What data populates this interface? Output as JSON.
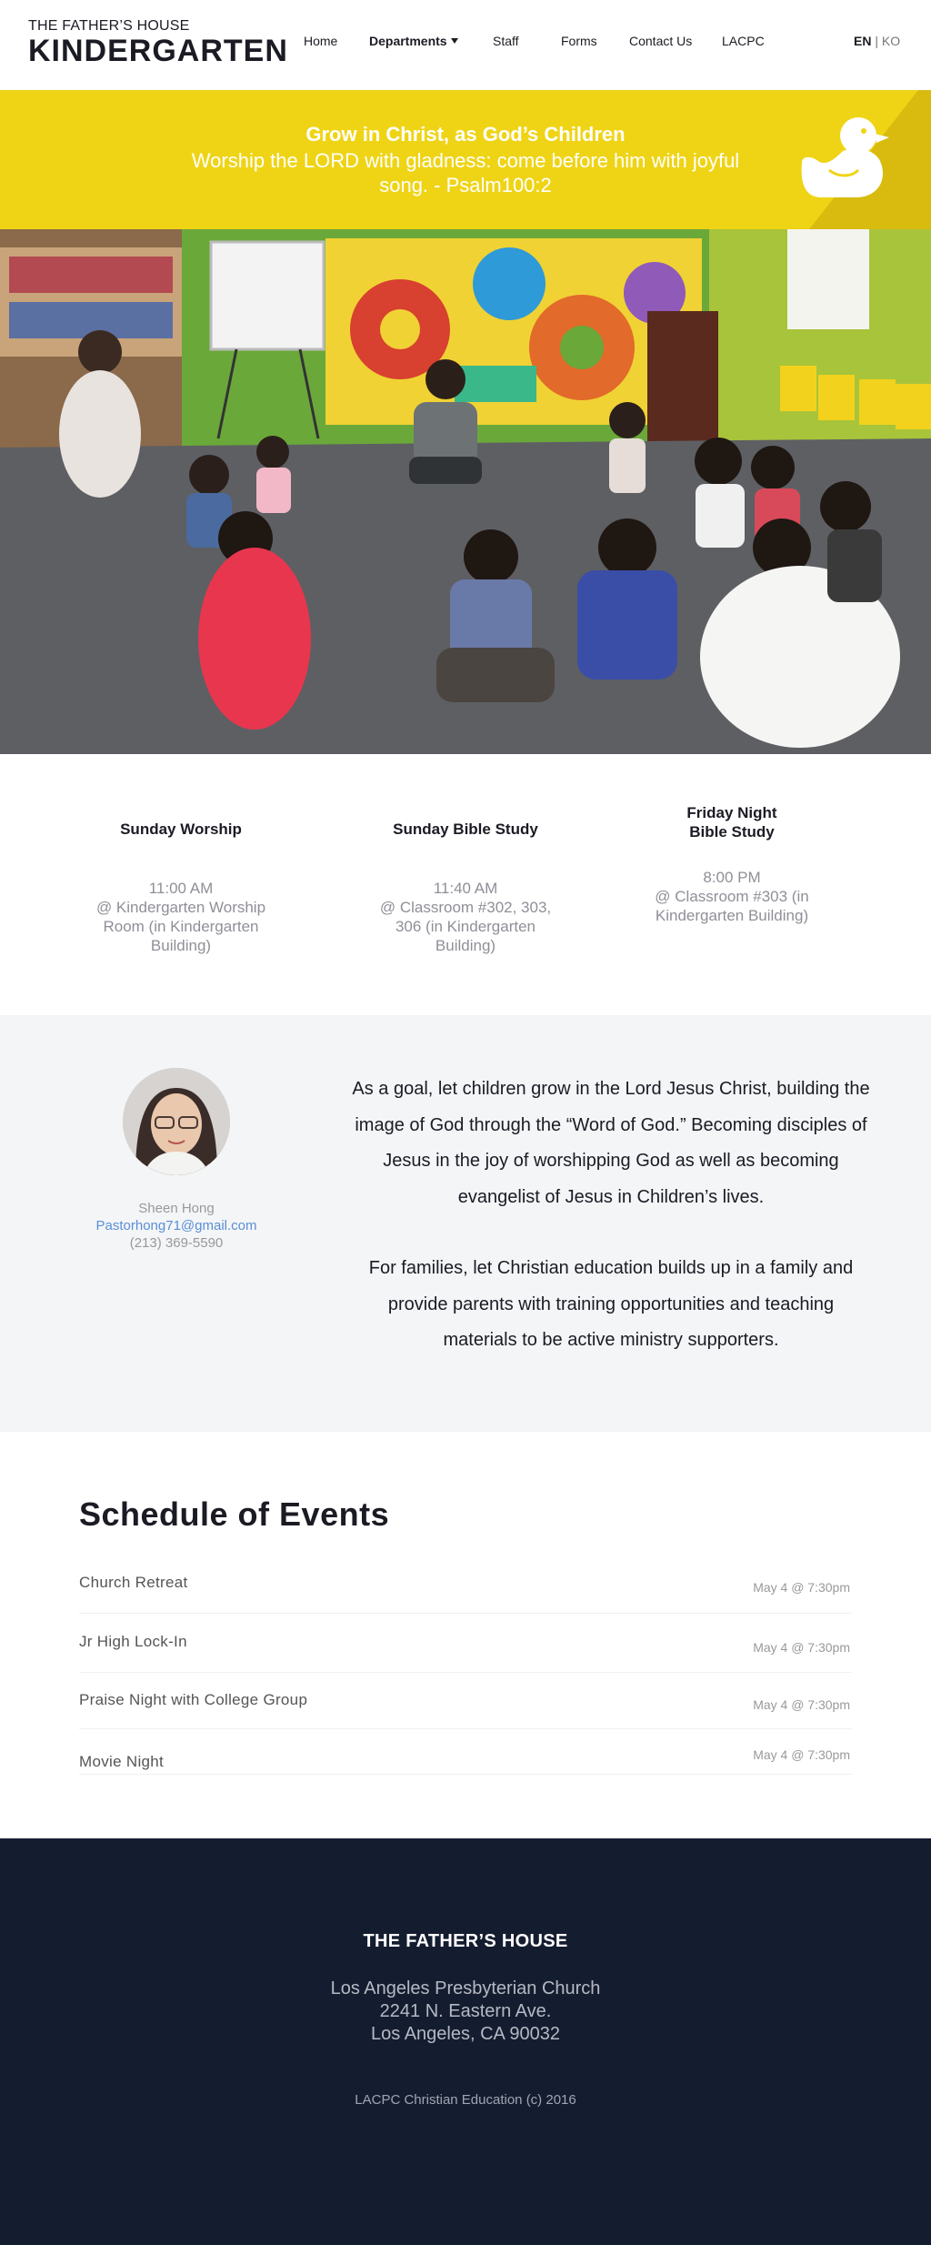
{
  "header": {
    "logo_top": "THE FATHER’S HOUSE",
    "logo_main": "KINDERGARTEN",
    "nav": [
      {
        "label": "Home"
      },
      {
        "label": "Departments"
      },
      {
        "label": "Staff"
      },
      {
        "label": "Forms"
      },
      {
        "label": "Contact Us"
      },
      {
        "label": "LACPC"
      }
    ],
    "lang_en": "EN",
    "lang_sep": "|",
    "lang_ko": "KO"
  },
  "banner": {
    "title": "Grow in Christ, as God’s Children",
    "verse": "Worship the LORD with gladness: come before him with joyful song. - Psalm100:2",
    "duck_icon": "rubber-duck-icon"
  },
  "services": [
    {
      "title": "Sunday Worship",
      "time": "11:00 AM",
      "place": "@ Kindergarten Worship Room (in Kindergarten Building)"
    },
    {
      "title": "Sunday Bible Study",
      "time": "11:40 AM",
      "place": "@ Classroom #302, 303, 306 (in Kindergarten Building)"
    },
    {
      "title": "Friday Night Bible Study",
      "time": "8:00 PM",
      "place": "@ Classroom #303 (in Kindergarten Building)"
    }
  ],
  "staff": {
    "name": "Sheen Hong",
    "email": "Pastorhong71@gmail.com",
    "phone": "(213) 369-5590"
  },
  "mission": {
    "p1": "As a goal, let children grow in the Lord Jesus Christ, building the image of God through the “Word of God.” Becoming disciples of Jesus in the joy of worshipping God as well as becoming evangelist of Jesus in Children’s lives.",
    "p2": "For families, let Christian education builds up in a family and provide parents with training opportunities and teaching materials to be active ministry supporters."
  },
  "schedule": {
    "title": "Schedule of Events",
    "events": [
      {
        "name": "Church Retreat",
        "date": "May 4 @ 7:30pm"
      },
      {
        "name": "Jr High Lock-In",
        "date": "May 4 @ 7:30pm"
      },
      {
        "name": "Praise Night with College Group",
        "date": "May 4 @ 7:30pm"
      },
      {
        "name": "Movie Night",
        "date": "May 4 @ 7:30pm"
      }
    ]
  },
  "footer": {
    "title": "THE FATHER’S HOUSE",
    "addr1": "Los Angeles Presbyterian Church",
    "addr2": "2241 N. Eastern Ave.",
    "addr3": "Los Angeles, CA 90032",
    "copyright": "LACPC Christian Education (c) 2016"
  },
  "colors": {
    "banner_yellow": "#efd416",
    "footer_navy": "#141d30",
    "link_blue": "#5a8fd6"
  }
}
